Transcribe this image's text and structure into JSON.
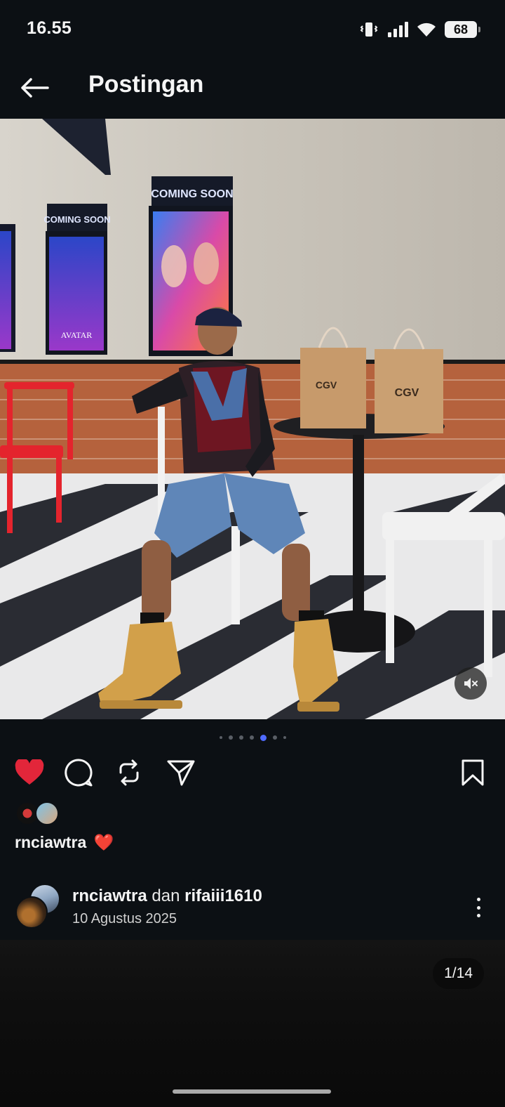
{
  "status_bar": {
    "time": "16.55",
    "battery": "68",
    "icons": [
      "vibrate-icon",
      "signal-icon",
      "wifi-icon",
      "battery-icon"
    ]
  },
  "header": {
    "title": "Postingan",
    "back_icon": "arrow-left-icon"
  },
  "media": {
    "mute_icon": "speaker-muted-icon",
    "sign_1": "COMING SOON",
    "sign_2": "COMING SOON",
    "poster_text": "AVATAR",
    "bag_brand": "CGV"
  },
  "carousel": {
    "dot_count": 7,
    "active_index": 4
  },
  "actions": {
    "liked": true,
    "icons": [
      "heart-icon",
      "comment-icon",
      "repost-icon",
      "share-icon",
      "bookmark-icon"
    ]
  },
  "likes": {
    "liked_by_user": "rnciawtra",
    "heart": "❤️"
  },
  "author": {
    "user1": "rnciawtra",
    "conjunction": "dan",
    "user2": "rifaiii1610",
    "date": "10 Agustus 2025"
  },
  "next_post": {
    "counter": "1/14"
  },
  "colors": {
    "background": "#0c1014",
    "like_red": "#e2263a",
    "active_dot": "#4f6bff"
  }
}
